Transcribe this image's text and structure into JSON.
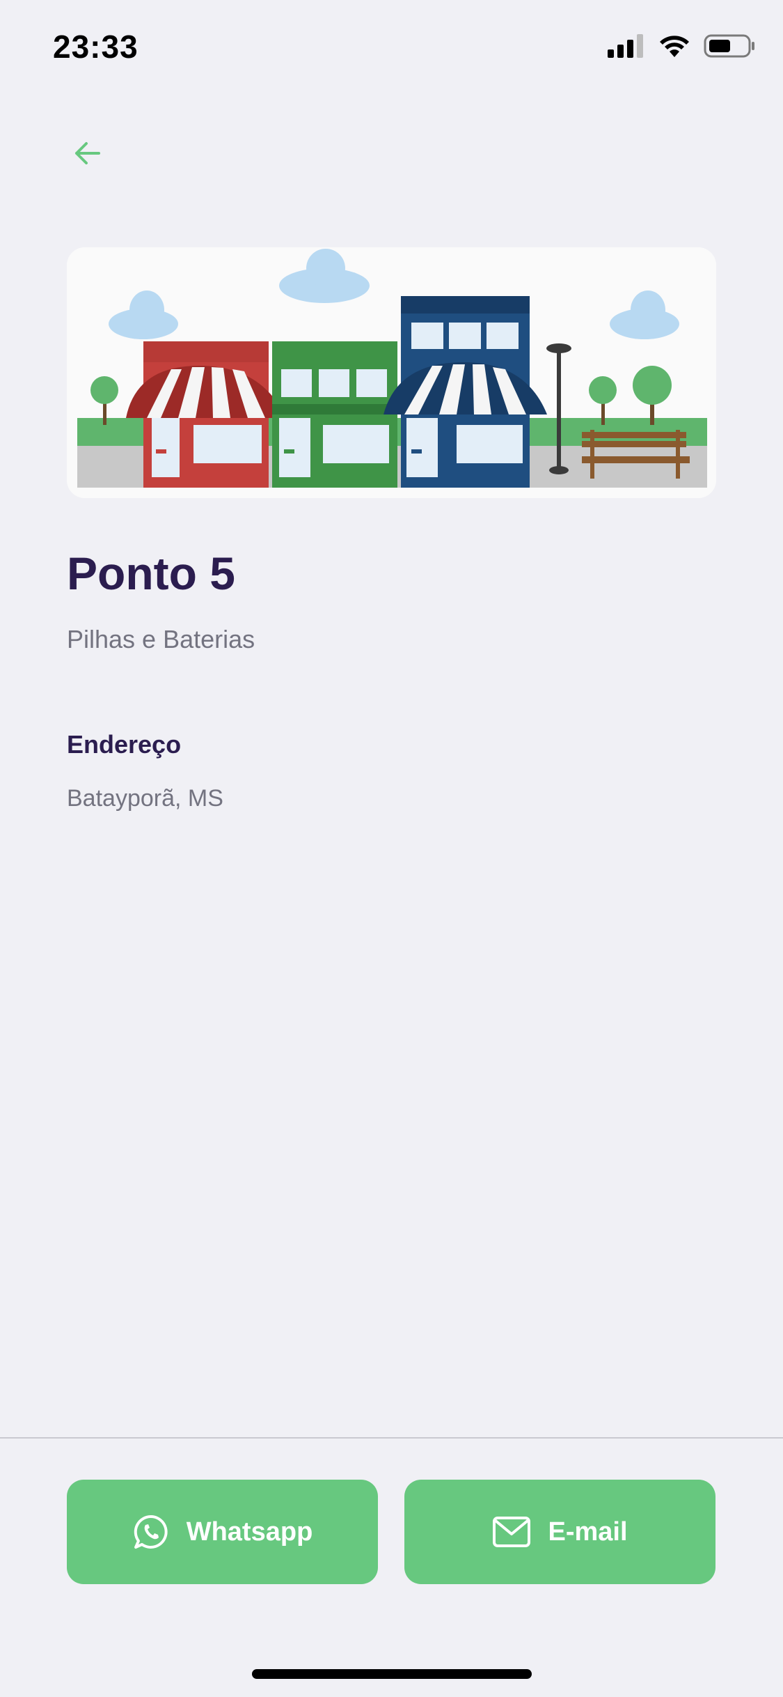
{
  "status_bar": {
    "time": "23:33",
    "icons": [
      "signal-icon",
      "wifi-icon",
      "battery-icon"
    ]
  },
  "header": {
    "back_icon": "arrow-left-icon"
  },
  "point": {
    "image": "stores-illustration",
    "title": "Ponto 5",
    "subtitle": "Pilhas e Baterias",
    "address_label": "Endereço",
    "address_value": "Batayporã, MS"
  },
  "actions": {
    "whatsapp_label": "Whatsapp",
    "whatsapp_icon": "whatsapp-icon",
    "email_label": "E-mail",
    "email_icon": "mail-icon"
  },
  "colors": {
    "accent": "#67c87f",
    "title": "#2b1d4f",
    "muted": "#737380",
    "background": "#f0f0f5"
  }
}
